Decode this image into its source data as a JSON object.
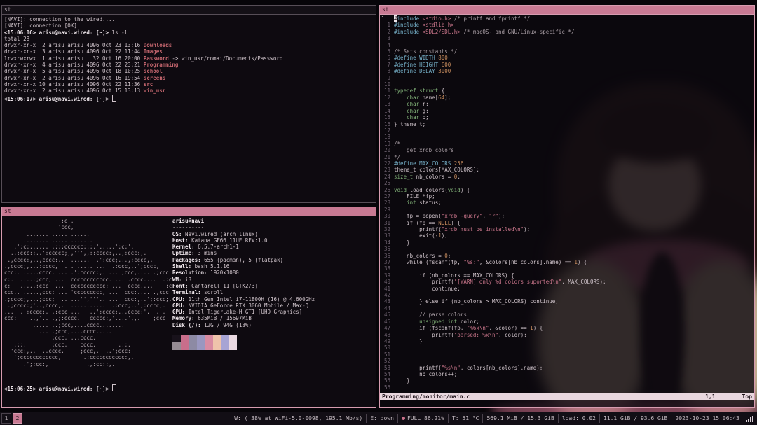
{
  "theme": {
    "bg": "#070509",
    "term_bg": "#0e0a10",
    "glass_bg": "rgba(13,9,15,0.8)",
    "fg": "#cfc3ca",
    "bold": "#efe7ec",
    "dir": "#c4666e",
    "pink": "#c87a93",
    "pink_text": "#331520",
    "pink_border": "#d79cb0",
    "unfocused_bg": "#141016",
    "unfocused_fg": "#aba1a8",
    "border_dim": "#574e57",
    "pp": "#74aec6",
    "str": "#c9758a",
    "num": "#c98d5e",
    "type": "#7fae76",
    "cmt": "#a89da4",
    "gut": "#6e6270",
    "sl_bg": "#e9d7de",
    "sl_fg": "#1d1118",
    "bar_bg": "#120e15",
    "bar_fg": "#c6bcc3",
    "sep": "#49414b",
    "art": "#b3a8af",
    "dot": "#c9718a",
    "wp_hair": "#33211c",
    "wp_hair2": "#2a1a16",
    "wp_face": "#bb9c8b",
    "wp_collar": "#b2607a",
    "wp_jacket": "#c2ab90",
    "wp_shirt": "#191114"
  },
  "windows": {
    "top_left": {
      "title": "st",
      "lines": [
        [
          [
            "n",
            "[NAVI]: connection to the wired...."
          ]
        ],
        [
          [
            "n",
            "[NAVI]: connection [OK]"
          ]
        ],
        [
          [
            "b",
            "<15:06:06> arisu@navi.wired: [~]> "
          ],
          [
            "n",
            "ls -l"
          ]
        ],
        [
          [
            "n",
            "total 28"
          ]
        ],
        [
          [
            "n",
            "drwxr-xr-x  2 arisu arisu 4096 Oct 23 13:16 "
          ],
          [
            "r",
            "Downloads"
          ]
        ],
        [
          [
            "n",
            "drwxr-xr-x  3 arisu arisu 4096 Oct 22 11:44 "
          ],
          [
            "r",
            "Images"
          ]
        ],
        [
          [
            "n",
            "lrwxrwxrwx  1 arisu arisu   32 Oct 16 20:00 "
          ],
          [
            "r",
            "Password"
          ],
          [
            "n",
            " -> win_usr/romai/Documents/Password"
          ]
        ],
        [
          [
            "n",
            "drwxr-xr-x  4 arisu arisu 4096 Oct 22 23:21 "
          ],
          [
            "r",
            "Programming"
          ]
        ],
        [
          [
            "n",
            "drwxr-xr-x  5 arisu arisu 4096 Oct 18 10:25 "
          ],
          [
            "r",
            "school"
          ]
        ],
        [
          [
            "n",
            "drwxr-xr-x  2 arisu arisu 4096 Oct 16 19:54 "
          ],
          [
            "r",
            "screens"
          ]
        ],
        [
          [
            "n",
            "drwxr-xr-x 10 arisu arisu 4096 Oct 22 11:36 "
          ],
          [
            "r",
            "src"
          ]
        ],
        [
          [
            "n",
            "drwxr-xr-x  2 arisu arisu 4096 Oct 15 13:13 "
          ],
          [
            "r",
            "win_usr"
          ]
        ],
        [
          [
            "b",
            "<15:06:17> arisu@navi.wired: [~]> "
          ],
          [
            "K",
            ""
          ]
        ]
      ]
    },
    "bottom_left": {
      "title": "st",
      "ascii_art": [
        "                  ;c:.",
        "                 'ccc,",
        "       ....................",
        "      ......................",
        "   .';c:,......,;;:cccccc::;,'.....':c;'.",
        "  .,:ccc:;..':ccccc;,,''',,::cccc:,..,:ccc:,.",
        " .,cccc:,..,cccc:..  ......  .':ccc;...,:cccc,.",
        ".,cccc;,...:cccc,  ... ..... ...  .:ccc,..';cccc,.",
        "ccc;. .....cccc. ... .':ccccc:,. ... ;ccc,.... .;ccc",
        "c:.  .....;ccc, ... .cccccccccccc. ... .cccc....  .:c",
        "c:   .....;ccc. ... 'ccccccccccc; ...  cccc....    ;c",
        "ccc,. .....,ccc: ... 'ccccccccc, ... 'ccc:.... .,ccc",
        ".;cccc;,...;ccc;  ......'','''.. ... 'ccc:,..';:ccc;.",
        " .;cccc:;'..,cccc,.  ...........  .:ccc;..',:cccc;.",
        "...  .':cccc;..,:ccc;,..   ..';cccc;..,cccc:'.  ...",
        "ccc:    .,,'....,;:cccc.   ccccc:,'....',,.    ;ccc",
        "         ........;ccc,....cccc........",
        "           .....;ccc,....cccc.....",
        "               ;ccc,....cccc.",
        "   .;;.        ;ccc.    cccc.       .;;.",
        "  'ccc:,..  ..cccc.     ;ccc,.  ..';ccc:",
        "   ';cccccccccccc,       .:ccccccccccc:,.",
        "      .';:cc:,.           .,:cc:;,."
      ],
      "fetch": {
        "user_host": "arisu@navi",
        "underline": "----------",
        "entries": [
          {
            "label": "OS",
            "value": "Navi.wired (arch linux)"
          },
          {
            "label": "Host",
            "value": "Katana GF66 11UE REV:1.0"
          },
          {
            "label": "Kernel",
            "value": "6.5.7-arch1-1"
          },
          {
            "label": "Uptime",
            "value": "3 mins"
          },
          {
            "label": "Packages",
            "value": "655 (pacman), 5 (flatpak)"
          },
          {
            "label": "Shell",
            "value": "bash 5.1.16"
          },
          {
            "label": "Resolution",
            "value": "1920x1080"
          },
          {
            "label": "WM",
            "value": "i3"
          },
          {
            "label": "Font",
            "value": "Cantarell 11 [GTK2/3]"
          },
          {
            "label": "Terminal",
            "value": "scroll"
          },
          {
            "label": "CPU",
            "value": "11th Gen Intel i7-11800H (16) @ 4.600GHz"
          },
          {
            "label": "GPU",
            "value": "NVIDIA GeForce RTX 3060 Mobile / Max-Q"
          },
          {
            "label": "GPU",
            "value": "Intel TigerLake-H GT1 [UHD Graphics]"
          },
          {
            "label": "Memory",
            "value": "635MiB / 15697MiB"
          },
          {
            "label": "Disk (/)",
            "value": "12G / 94G (13%)"
          }
        ],
        "palette_row1": [
          "#18121b",
          "#c96e8b",
          "#8d8aa4",
          "#9a97c0",
          "#d98ba2",
          "#efc3ab",
          "#a7a4d4",
          "#ead9e2"
        ],
        "palette_row2": [
          "#958b93",
          "#c96e8b",
          "#8d8aa4",
          "#9a97c0",
          "#d98ba2",
          "#efc3ab",
          "#a7a4d4",
          "#ead9e2"
        ]
      },
      "prompt": [
        [
          "b",
          "<15:06:25> arisu@navi.wired: [~]> "
        ],
        [
          "K",
          ""
        ]
      ]
    },
    "right": {
      "title": "st",
      "editor": {
        "rows": [
          [
            "1",
            [
              [
                "B",
                "#"
              ],
              [
                "p",
                "include"
              ],
              [
                "n",
                " "
              ],
              [
                "s",
                "<stdio.h>"
              ],
              [
                "n",
                " "
              ],
              [
                "c",
                "/* printf and fprintf */"
              ]
            ],
            1
          ],
          [
            "1",
            [
              [
                "p",
                "#include"
              ],
              [
                "n",
                " "
              ],
              [
                "s",
                "<stdlib.h>"
              ]
            ]
          ],
          [
            "2",
            [
              [
                "p",
                "#include"
              ],
              [
                "n",
                " "
              ],
              [
                "s",
                "<SDL2/SDL.h>"
              ],
              [
                "n",
                " "
              ],
              [
                "c",
                "/* macOS- and GNU/Linux-specific */"
              ]
            ]
          ],
          [
            "3",
            []
          ],
          [
            "4",
            []
          ],
          [
            "5",
            [
              [
                "c",
                "/* Sets constants */"
              ]
            ]
          ],
          [
            "6",
            [
              [
                "p",
                "#define WIDTH "
              ],
              [
                "u",
                "800"
              ]
            ]
          ],
          [
            "7",
            [
              [
                "p",
                "#define HEIGHT "
              ],
              [
                "u",
                "600"
              ]
            ]
          ],
          [
            "8",
            [
              [
                "p",
                "#define DELAY "
              ],
              [
                "u",
                "3000"
              ]
            ]
          ],
          [
            "9",
            []
          ],
          [
            "10",
            []
          ],
          [
            "11",
            [
              [
                "t",
                "typedef struct"
              ],
              [
                "n",
                " {"
              ]
            ]
          ],
          [
            "12",
            [
              [
                "n",
                "    "
              ],
              [
                "t",
                "char"
              ],
              [
                "n",
                " name["
              ],
              [
                "u",
                "64"
              ],
              [
                "n",
                "];"
              ]
            ]
          ],
          [
            "13",
            [
              [
                "n",
                "    "
              ],
              [
                "t",
                "char"
              ],
              [
                "n",
                " r;"
              ]
            ]
          ],
          [
            "14",
            [
              [
                "n",
                "    "
              ],
              [
                "t",
                "char"
              ],
              [
                "n",
                " g;"
              ]
            ]
          ],
          [
            "15",
            [
              [
                "n",
                "    "
              ],
              [
                "t",
                "char"
              ],
              [
                "n",
                " b;"
              ]
            ]
          ],
          [
            "16",
            [
              [
                "n",
                "} theme_t;"
              ]
            ]
          ],
          [
            "17",
            []
          ],
          [
            "18",
            []
          ],
          [
            "19",
            [
              [
                "c",
                "/*"
              ]
            ]
          ],
          [
            "20",
            [
              [
                "c",
                "    get xrdb colors"
              ]
            ]
          ],
          [
            "21",
            [
              [
                "c",
                "*/"
              ]
            ]
          ],
          [
            "22",
            [
              [
                "p",
                "#define MAX_COLORS "
              ],
              [
                "u",
                "256"
              ]
            ]
          ],
          [
            "23",
            [
              [
                "n",
                "theme_t colors[MAX_COLORS];"
              ]
            ]
          ],
          [
            "24",
            [
              [
                "t",
                "size_t"
              ],
              [
                "n",
                " nb_colors = "
              ],
              [
                "u",
                "0"
              ],
              [
                "n",
                ";"
              ]
            ]
          ],
          [
            "25",
            []
          ],
          [
            "26",
            [
              [
                "t",
                "void"
              ],
              [
                "n",
                " load_colors("
              ],
              [
                "t",
                "void"
              ],
              [
                "n",
                ") {"
              ]
            ]
          ],
          [
            "27",
            [
              [
                "n",
                "    FILE *fp;"
              ]
            ]
          ],
          [
            "28",
            [
              [
                "n",
                "    "
              ],
              [
                "t",
                "int"
              ],
              [
                "n",
                " status;"
              ]
            ]
          ],
          [
            "29",
            []
          ],
          [
            "30",
            [
              [
                "n",
                "    fp = popen("
              ],
              [
                "s",
                "\"xrdb -query\""
              ],
              [
                "n",
                ", "
              ],
              [
                "s",
                "\"r\""
              ],
              [
                "n",
                ");"
              ]
            ]
          ],
          [
            "31",
            [
              [
                "n",
                "    if (fp == "
              ],
              [
                "u",
                "NULL"
              ],
              [
                "n",
                ") {"
              ]
            ]
          ],
          [
            "32",
            [
              [
                "n",
                "        printf("
              ],
              [
                "s",
                "\"xrdb must be installed\\n\""
              ],
              [
                "n",
                ");"
              ]
            ]
          ],
          [
            "33",
            [
              [
                "n",
                "        exit(-"
              ],
              [
                "u",
                "1"
              ],
              [
                "n",
                ");"
              ]
            ]
          ],
          [
            "34",
            [
              [
                "n",
                "    }"
              ]
            ]
          ],
          [
            "35",
            []
          ],
          [
            "36",
            [
              [
                "n",
                "    nb_colors = "
              ],
              [
                "u",
                "0"
              ],
              [
                "n",
                ";"
              ]
            ]
          ],
          [
            "37",
            [
              [
                "n",
                "    while (fscanf(fp, "
              ],
              [
                "s",
                "\"%s:\""
              ],
              [
                "n",
                ", &colors[nb_colors].name) == "
              ],
              [
                "u",
                "1"
              ],
              [
                "n",
                ") {"
              ]
            ]
          ],
          [
            "38",
            []
          ],
          [
            "39",
            [
              [
                "n",
                "        if (nb_colors == MAX_COLORS) {"
              ]
            ]
          ],
          [
            "40",
            [
              [
                "n",
                "            printf("
              ],
              [
                "s",
                "\"[WARN] only %d colors suported\\n\""
              ],
              [
                "n",
                ", MAX_COLORS);"
              ]
            ]
          ],
          [
            "41",
            [
              [
                "n",
                "            continue;"
              ]
            ]
          ],
          [
            "42",
            []
          ],
          [
            "43",
            [
              [
                "n",
                "        } else if (nb_colors > MAX_COLORS) continue;"
              ]
            ]
          ],
          [
            "44",
            []
          ],
          [
            "45",
            [
              [
                "c",
                "        // parse colors"
              ]
            ]
          ],
          [
            "46",
            [
              [
                "n",
                "        "
              ],
              [
                "t",
                "unsigned int"
              ],
              [
                "n",
                " color;"
              ]
            ]
          ],
          [
            "47",
            [
              [
                "n",
                "        if (fscanf(fp, "
              ],
              [
                "s",
                "\"%6x\\n\""
              ],
              [
                "n",
                ", &color) == "
              ],
              [
                "u",
                "1"
              ],
              [
                "n",
                ") {"
              ]
            ]
          ],
          [
            "48",
            [
              [
                "n",
                "            printf("
              ],
              [
                "s",
                "\"parsed: %x\\n\""
              ],
              [
                "n",
                ", color);"
              ]
            ]
          ],
          [
            "49",
            [
              [
                "n",
                "        }"
              ]
            ]
          ],
          [
            "50",
            []
          ],
          [
            "51",
            []
          ],
          [
            "52",
            []
          ],
          [
            "53",
            [
              [
                "n",
                "        printf("
              ],
              [
                "s",
                "\"%s\\n\""
              ],
              [
                "n",
                ", colors[nb_colors].name);"
              ]
            ]
          ],
          [
            "54",
            [
              [
                "n",
                "        nb_colors++;"
              ]
            ]
          ],
          [
            "55",
            [
              [
                "n",
                "    }"
              ]
            ]
          ],
          [
            "56",
            []
          ]
        ],
        "statusline": {
          "file": "Programming/monitor/main.c",
          "position": "1,1",
          "scroll": "Top"
        }
      }
    }
  },
  "statusbar": {
    "workspaces": [
      {
        "label": "1",
        "active": false
      },
      {
        "label": "2",
        "active": true
      }
    ],
    "segments": [
      {
        "text": "W: ( 38% at WiFi-5.0-0098, 195.1 Mb/s)"
      },
      {
        "text": "E: down"
      },
      {
        "icon": "battery-dot",
        "text": "FULL 86.21%"
      },
      {
        "text": "T: 51 °C"
      },
      {
        "text": "569.1 MiB / 15.3 GiB"
      },
      {
        "text": "load: 0.02"
      },
      {
        "text": "11.1 GiB / 93.6 GiB"
      },
      {
        "text": "2023-10-23 15:06:43"
      }
    ],
    "signal_icon": "signal-bars"
  }
}
